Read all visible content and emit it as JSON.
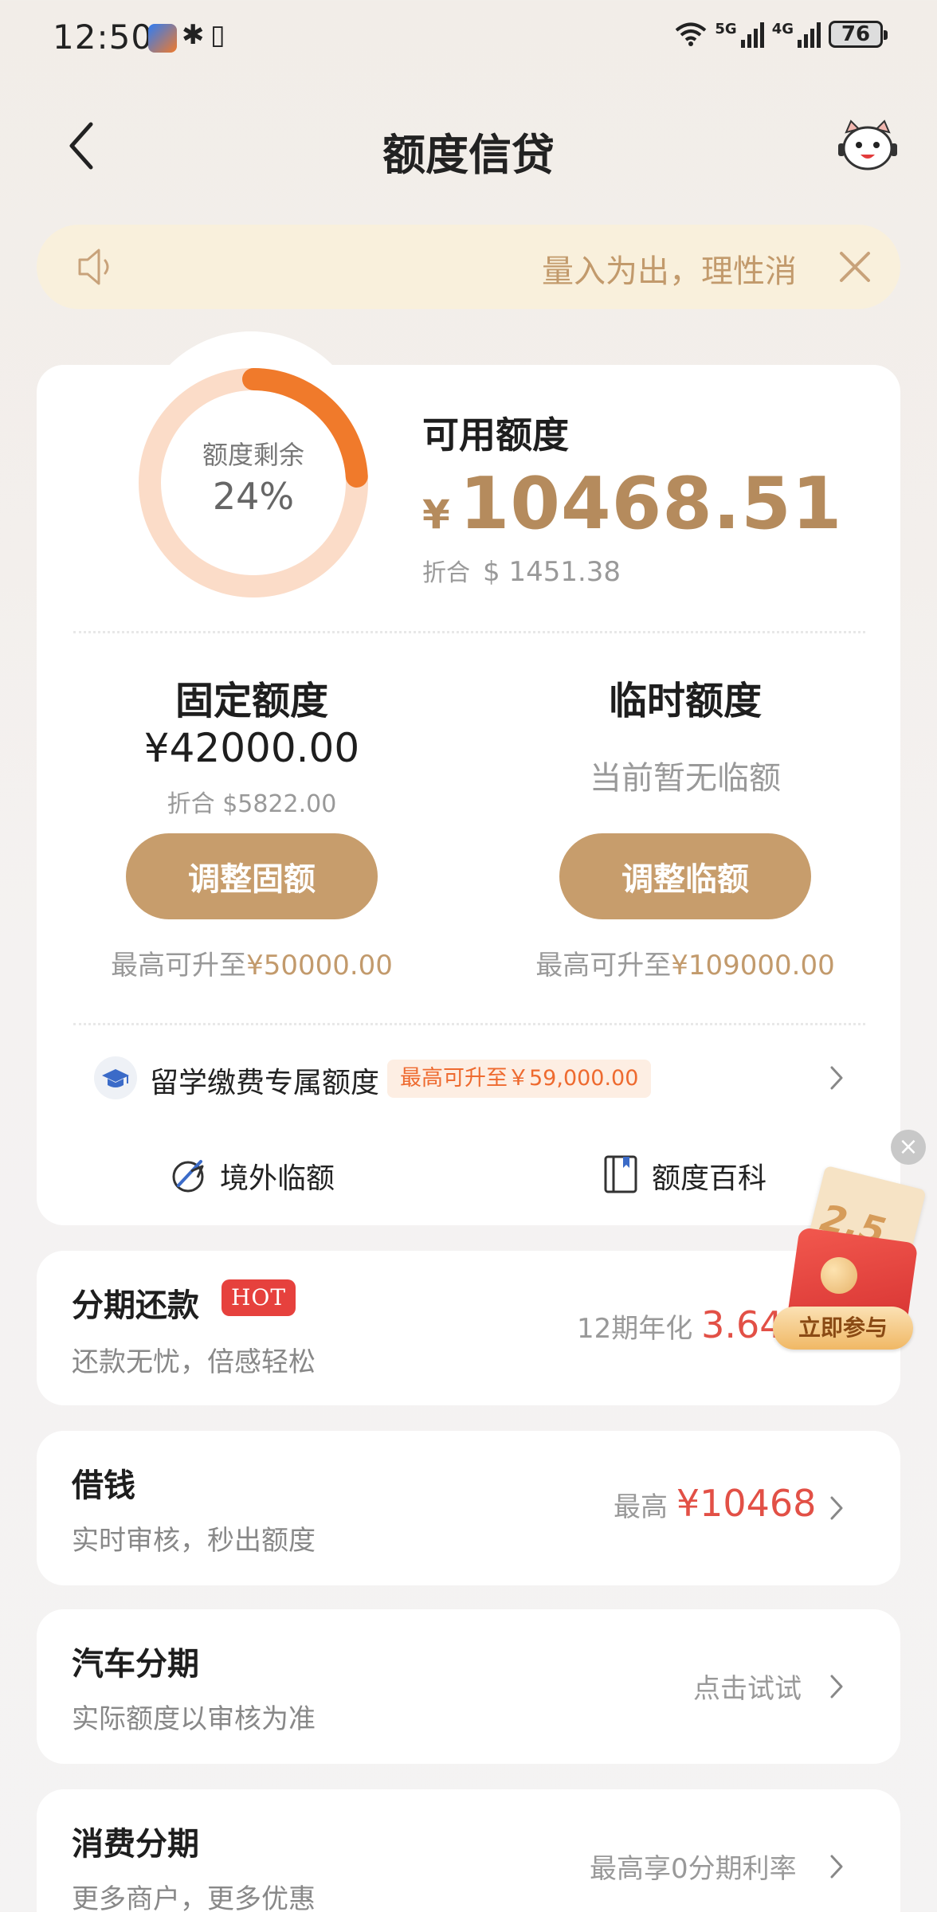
{
  "status_bar": {
    "time": "12:50",
    "sim1": "5G",
    "sim2": "4G",
    "battery": "76"
  },
  "header": {
    "title": "额度信贷"
  },
  "notice": {
    "text": "量入为出，理性消"
  },
  "credit": {
    "ring_label": "额度剩余",
    "ring_percent_text": "24%",
    "remaining_fraction": 0.24,
    "available_title": "可用额度",
    "currency_symbol": "¥",
    "available_amount": "10468.51",
    "usd_prefix": "折合",
    "usd_amount": "$ 1451.38",
    "accent_color": "#f07a2b",
    "track_color": "#fbdcc8"
  },
  "fixed": {
    "title": "固定额度",
    "amount": "¥42000.00",
    "usd": "折合 $5822.00",
    "button": "调整固额",
    "note_prefix": "最高可升至",
    "note_value": "¥50000.00"
  },
  "temp": {
    "title": "临时额度",
    "status": "当前暂无临额",
    "button": "调整临额",
    "note_prefix": "最高可升至",
    "note_value": "¥109000.00"
  },
  "study": {
    "label": "留学缴费专属额度",
    "badge": "最高可升至￥59,000.00"
  },
  "links": {
    "overseas": "境外临额",
    "wiki": "额度百科"
  },
  "promo": {
    "badge_text": "2.5",
    "button": "立即参与"
  },
  "list": [
    {
      "title": "分期还款",
      "hot": "HOT",
      "subtitle": "还款无忧，倍感轻松",
      "right_prefix": "12期年化",
      "right_value": "3.64"
    },
    {
      "title": "借钱",
      "subtitle": "实时审核，秒出额度",
      "right_prefix": "最高",
      "right_value": "¥10468"
    },
    {
      "title": "汽车分期",
      "subtitle": "实际额度以审核为准",
      "right_prefix": "点击试试",
      "right_value": ""
    },
    {
      "title": "消费分期",
      "subtitle": "更多商户，更多优惠",
      "right_prefix": "最高享0分期利率",
      "right_value": ""
    }
  ]
}
